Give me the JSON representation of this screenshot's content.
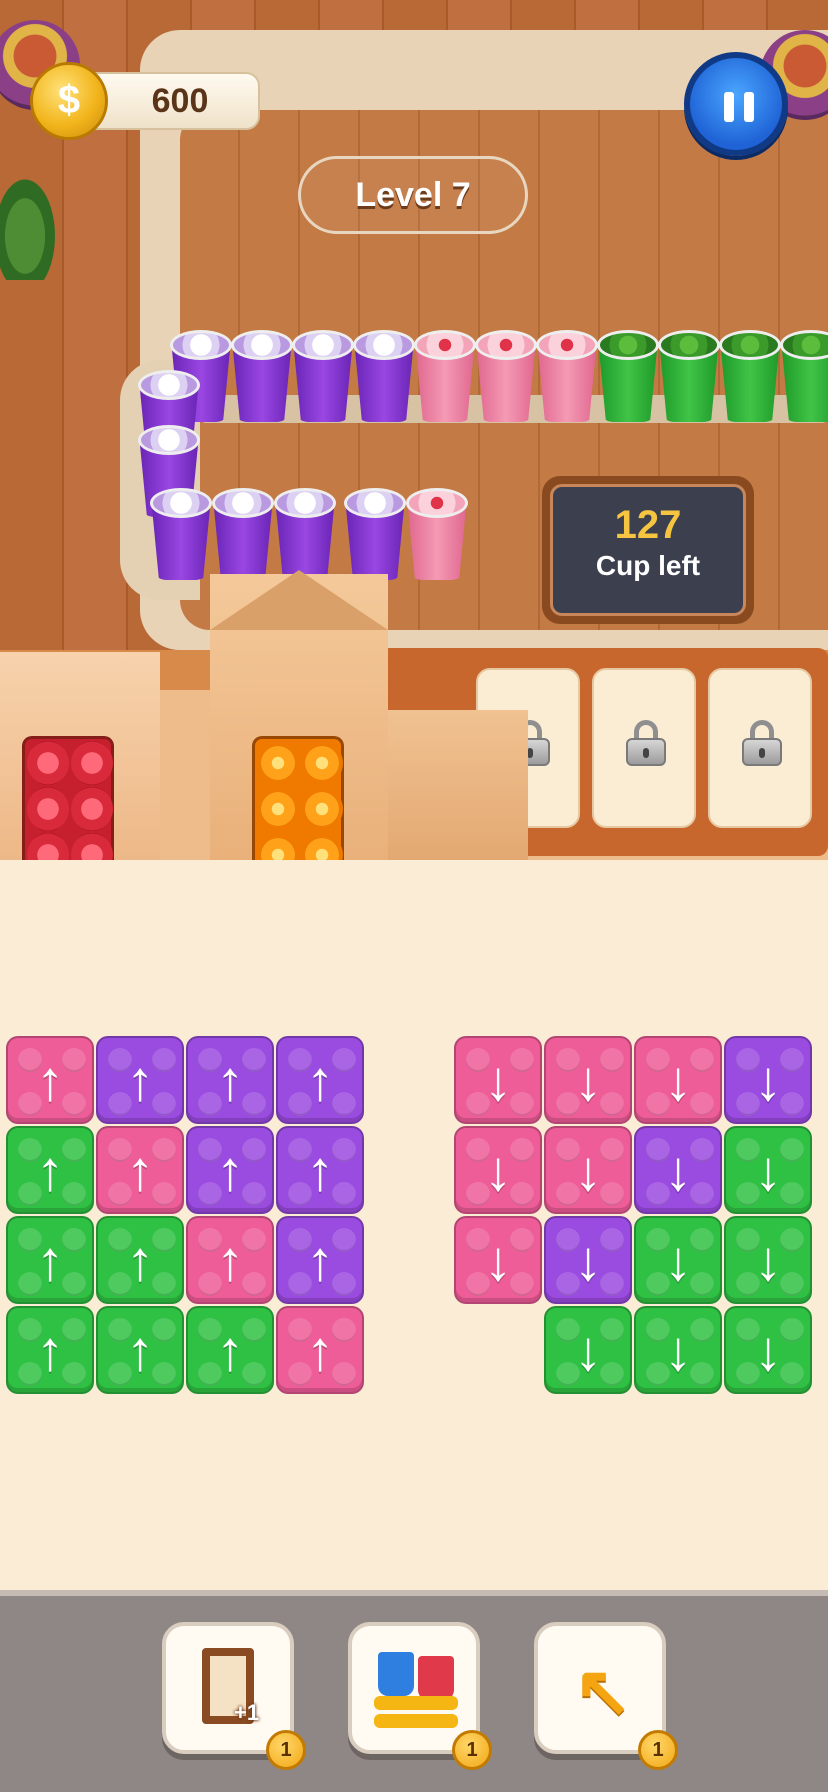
{
  "hud": {
    "coins": "600",
    "level": "Level 7"
  },
  "cups_board": {
    "count": "127",
    "label": "Cup left"
  },
  "queue_cups": [
    "purple",
    "purple",
    "purple",
    "purple",
    "pink",
    "pink",
    "pink",
    "green",
    "green",
    "green",
    "green"
  ],
  "slots": [
    {
      "state": "locked",
      "icon": "lock-icon"
    },
    {
      "state": "locked",
      "icon": "lock-icon"
    },
    {
      "state": "locked",
      "icon": "lock-icon"
    }
  ],
  "trays": [
    {
      "color": "red",
      "cups": 8
    },
    {
      "color": "orange",
      "cups": 8
    }
  ],
  "grid_left": {
    "direction": "up",
    "rows": [
      [
        "pink",
        "purple",
        "purple",
        "purple"
      ],
      [
        "green",
        "pink",
        "purple",
        "purple"
      ],
      [
        "green",
        "green",
        "pink",
        "purple"
      ],
      [
        "green",
        "green",
        "green",
        "pink"
      ]
    ]
  },
  "grid_right": {
    "direction": "down",
    "rows": [
      [
        "pink",
        "pink",
        "pink",
        "purple"
      ],
      [
        "pink",
        "pink",
        "purple",
        "green"
      ],
      [
        "pink",
        "purple",
        "green",
        "green"
      ],
      [
        null,
        "green",
        "green",
        "green"
      ]
    ]
  },
  "arrows": {
    "up": "↑",
    "down": "↓"
  },
  "tools": [
    {
      "name": "extra-slot",
      "badge": "1",
      "icon_label": "+1"
    },
    {
      "name": "swap",
      "badge": "1"
    },
    {
      "name": "undo",
      "badge": "1"
    }
  ],
  "colors": {
    "pink": "#ee5d97",
    "purple": "#9a4be0",
    "green": "#2fc144",
    "red": "#d82a3a",
    "orange": "#f07a00",
    "accent_gold": "#f5c542",
    "pause_blue": "#1f63d6"
  }
}
